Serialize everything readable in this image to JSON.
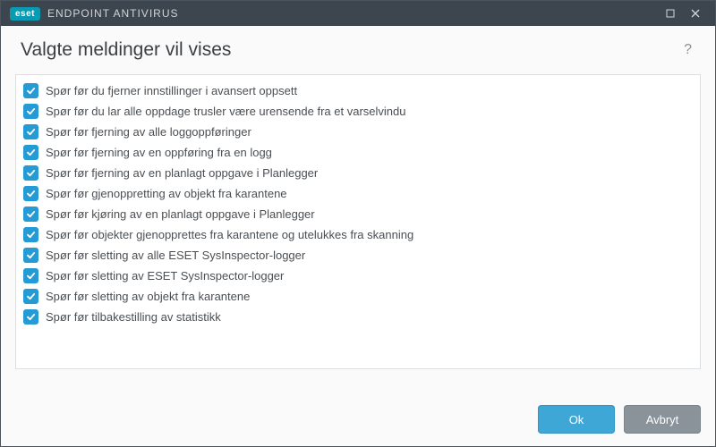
{
  "app": {
    "brand_badge": "eset",
    "brand_text": "ENDPOINT ANTIVIRUS"
  },
  "header": {
    "title": "Valgte meldinger vil vises",
    "help_symbol": "?"
  },
  "list": {
    "items": [
      {
        "checked": true,
        "label": "Spør før du fjerner innstillinger i avansert oppsett"
      },
      {
        "checked": true,
        "label": "Spør før du lar alle oppdage trusler være urensende fra et varselvindu"
      },
      {
        "checked": true,
        "label": "Spør før fjerning av alle loggoppføringer"
      },
      {
        "checked": true,
        "label": "Spør før fjerning av en oppføring fra en logg"
      },
      {
        "checked": true,
        "label": "Spør før fjerning av en planlagt oppgave i Planlegger"
      },
      {
        "checked": true,
        "label": "Spør før gjenoppretting av objekt fra karantene"
      },
      {
        "checked": true,
        "label": "Spør før kjøring av en planlagt oppgave i Planlegger"
      },
      {
        "checked": true,
        "label": "Spør før objekter gjenopprettes fra karantene og utelukkes fra skanning"
      },
      {
        "checked": true,
        "label": "Spør før sletting av alle ESET SysInspector-logger"
      },
      {
        "checked": true,
        "label": "Spør før sletting av ESET SysInspector-logger"
      },
      {
        "checked": true,
        "label": "Spør før sletting av objekt fra karantene"
      },
      {
        "checked": true,
        "label": "Spør før tilbakestilling av statistikk"
      }
    ]
  },
  "footer": {
    "ok_label": "Ok",
    "cancel_label": "Avbryt"
  },
  "colors": {
    "accent": "#259bd6",
    "titlebar": "#3d464f",
    "brand": "#0a9bb3"
  }
}
